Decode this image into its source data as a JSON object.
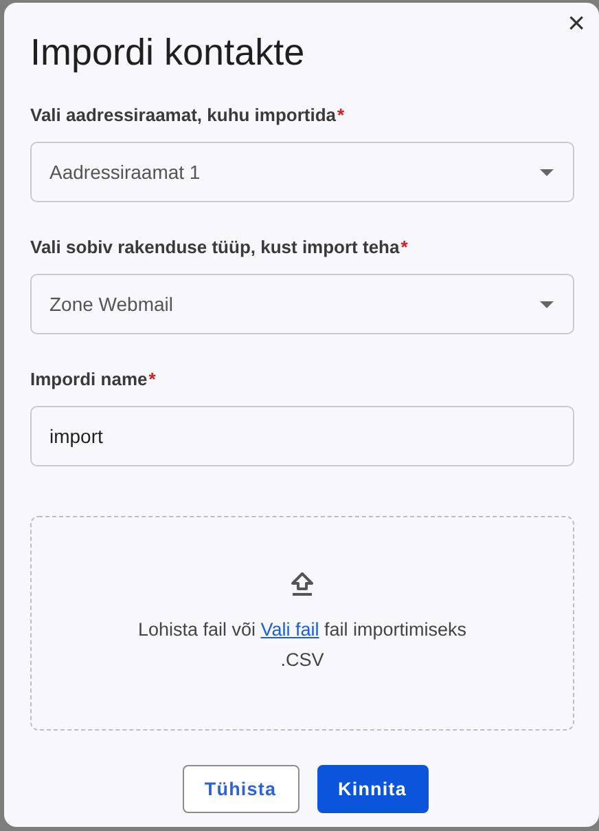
{
  "dialog": {
    "title": "Impordi kontakte",
    "close": "×"
  },
  "fields": [
    {
      "kind": "select",
      "label": "Vali aadressiraamat, kuhu importida",
      "required_mark": "*",
      "value": "Aadressiraamat 1"
    },
    {
      "kind": "select",
      "label": "Vali sobiv rakenduse tüüp, kust import teha",
      "required_mark": "*",
      "value": "Zone Webmail"
    },
    {
      "kind": "input",
      "label": "Impordi name",
      "required_mark": "*",
      "value": "import"
    }
  ],
  "dropzone": {
    "text_before": "Lohista fail või ",
    "link": "Vali fail",
    "text_after": " fail importimiseks",
    "formats": ".CSV"
  },
  "buttons": [
    {
      "kind": "outlined",
      "label": "Tühista"
    },
    {
      "kind": "primary",
      "label": "Kinnita"
    }
  ]
}
